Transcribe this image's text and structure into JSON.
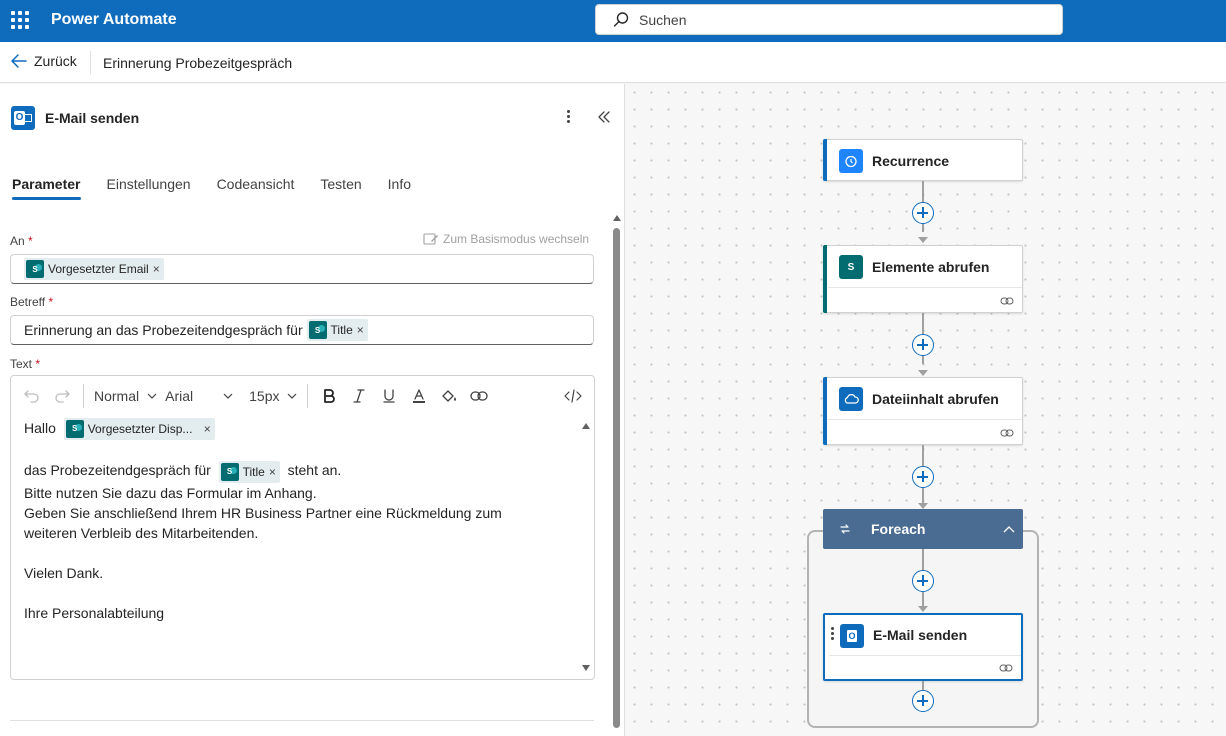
{
  "app": {
    "title": "Power Automate",
    "search_placeholder": "Suchen"
  },
  "cmdbar": {
    "back_label": "Zurück",
    "flow_name": "Erinnerung Probezeitgespräch"
  },
  "panel": {
    "title": "E-Mail senden",
    "tabs": [
      "Parameter",
      "Einstellungen",
      "Codeansicht",
      "Testen",
      "Info"
    ],
    "active_tab": "Parameter",
    "basic_mode_label": "Zum Basismodus wechseln",
    "to": {
      "label": "An",
      "required_mark": "*",
      "token": "Vorgesetzter Email"
    },
    "subject": {
      "label": "Betreff",
      "required_mark": "*",
      "prefix_text": "Erinnerung an das Probezeitendgespräch für",
      "token": "Title"
    },
    "body": {
      "label": "Text",
      "required_mark": "*",
      "toolbar": {
        "format": "Normal",
        "font": "Arial",
        "size": "15px"
      },
      "greeting": "Hallo",
      "greeting_token": "Vorgesetzter Disp...",
      "line1_prefix": "das Probezeitendgespräch für",
      "line1_token": "Title",
      "line1_suffix": "steht an.",
      "line2": "Bitte nutzen Sie dazu das Formular im Anhang.",
      "line3": "Geben Sie anschließend Ihrem HR Business Partner eine Rückmeldung zum",
      "line4": "weiteren Verbleib des Mitarbeitenden.",
      "line5": "Vielen Dank.",
      "line6": "Ihre Personalabteilung"
    },
    "token_remove_glyph": "×"
  },
  "canvas": {
    "nodes": [
      {
        "title": "Recurrence",
        "accent": "#0f6cbd",
        "icon": "alarm-clock-icon",
        "icon_color": "#1f85ff"
      },
      {
        "title": "Elemente abrufen",
        "accent": "#036c70",
        "icon": "sharepoint-icon",
        "icon_color": "#036c70"
      },
      {
        "title": "Dateiinhalt abrufen",
        "accent": "#0f6cbd",
        "icon": "onedrive-cloud-icon",
        "icon_color": "#0f6cbd"
      },
      {
        "title": "Foreach",
        "accent": "#4a6b92",
        "icon": "loop-icon",
        "icon_color": "#4a6b92"
      },
      {
        "title": "E-Mail senden",
        "accent": "#0f6cbd",
        "icon": "outlook-icon",
        "icon_color": "#0f6cbd"
      }
    ]
  },
  "colors": {
    "brand": "#0f6cbd",
    "foreach": "#4a6b92",
    "sharepoint": "#036c70"
  }
}
